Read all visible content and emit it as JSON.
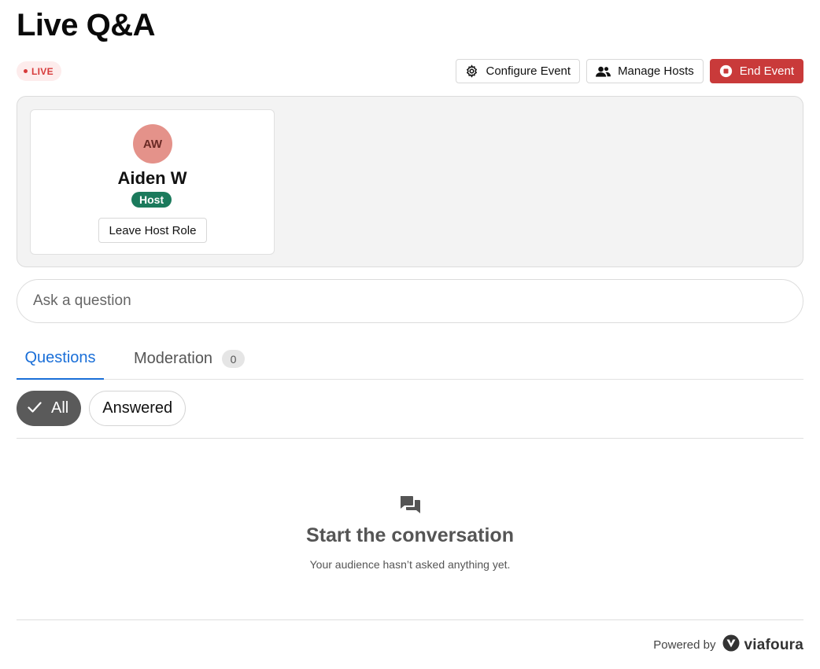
{
  "page": {
    "title": "Live Q&A"
  },
  "status": {
    "live_label": "LIVE"
  },
  "toolbar": {
    "configure_label": "Configure Event",
    "manage_hosts_label": "Manage Hosts",
    "end_event_label": "End Event"
  },
  "host": {
    "initials": "AW",
    "name": "Aiden W",
    "role_badge": "Host",
    "leave_label": "Leave Host Role"
  },
  "ask": {
    "placeholder": "Ask a question",
    "value": ""
  },
  "tabs": [
    {
      "label": "Questions",
      "active": true
    },
    {
      "label": "Moderation",
      "count": "0"
    }
  ],
  "filters": [
    {
      "label": "All",
      "selected": true
    },
    {
      "label": "Answered",
      "selected": false
    }
  ],
  "empty_state": {
    "icon": "chat-bubbles-icon",
    "title": "Start the conversation",
    "subtitle": "Your audience hasn’t asked anything yet."
  },
  "footer": {
    "powered_by": "Powered by",
    "brand": "viafoura"
  },
  "colors": {
    "accent_blue": "#1a6fd8",
    "live_red": "#d73a3a",
    "end_event_red": "#c93a3a",
    "host_green": "#1b7a5c",
    "avatar_bg": "#e4928a",
    "chip_selected_bg": "#5a5a5a"
  }
}
